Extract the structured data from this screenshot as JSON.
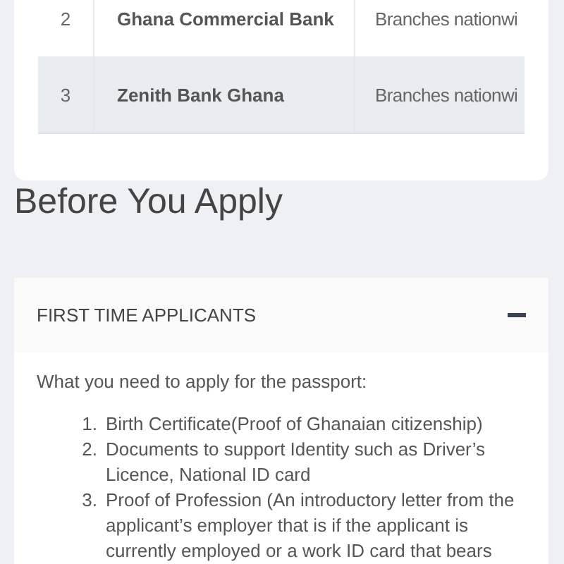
{
  "table": {
    "rows": [
      {
        "number": "2",
        "bank": "Ghana Commercial Bank",
        "location": "Branches nationwi",
        "shaded": false
      },
      {
        "number": "3",
        "bank": "Zenith Bank Ghana",
        "location": "Branches nationwi",
        "shaded": true
      }
    ]
  },
  "heading": "Before You Apply",
  "accordion": {
    "title": "FIRST TIME APPLICANTS",
    "expanded": true,
    "intro": "What you need to apply for the passport:",
    "items": [
      {
        "number": "1.",
        "text": "Birth Certificate(Proof of Ghanaian citizenship)"
      },
      {
        "number": "2.",
        "text": "Documents to support Identity such as Driver’s Licence, National ID card"
      },
      {
        "number": "3.",
        "text": "Proof of Profession (An introductory letter from the applicant’s employer that is if the applicant is currently employed or a work ID card that bears"
      }
    ]
  }
}
